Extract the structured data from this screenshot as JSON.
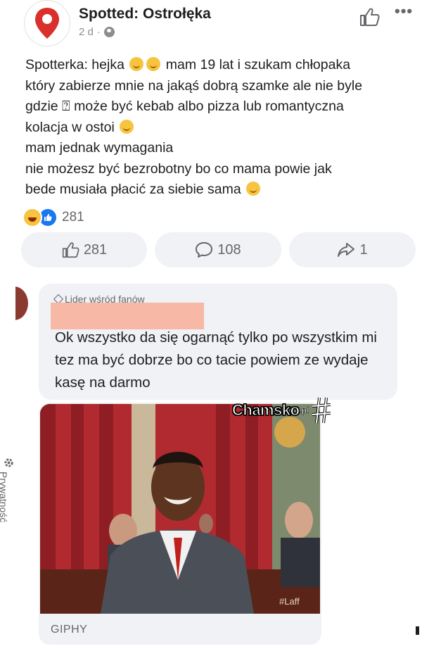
{
  "post": {
    "page_name": "Spotted: Ostrołęka",
    "time": "2 d",
    "separator": "·",
    "more": "•••",
    "lines": [
      {
        "before": "Spotterka: hejka ",
        "emojis": 2,
        "after": " mam 19 lat i szukam chłopaka"
      },
      {
        "before": "który zabierze mnie na jakąś dobrą szamke ale nie byle",
        "emojis": 0,
        "after": ""
      },
      {
        "before": "gdzie ⍰ może być kebab albo pizza lub romantyczna",
        "emojis": 0,
        "after": ""
      },
      {
        "before": "kolacja w ostoi ",
        "emojis": 1,
        "after": ""
      },
      {
        "before": "mam jednak wymagania",
        "emojis": 0,
        "after": ""
      },
      {
        "before": "nie możesz być bezrobotny bo co mama powie jak",
        "emojis": 0,
        "after": ""
      },
      {
        "before": "bede musiała płacić za siebie sama ",
        "emojis": 1,
        "after": ""
      }
    ],
    "reaction_count": "281"
  },
  "actions": {
    "like_count": "281",
    "comment_count": "108",
    "share_count": "1"
  },
  "comment": {
    "badge": "Lider wśród fanów",
    "text": "Ok wszystko da się ogarnąć tylko po wszystkim mi tez ma być dobrze bo co tacie powiem ze wydaje kasę na darmo",
    "gif_label": "GIPHY",
    "gif_caption": "#Laff"
  },
  "watermark": {
    "name": "Chamsko",
    "tld": ".pl"
  },
  "sidebar": {
    "privacy_label": "Prywatność"
  },
  "colors": {
    "accent_blue": "#1877f2",
    "bubble_bg": "#f0f2f5",
    "muted_text": "#65676b",
    "redaction": "#f7b9a6"
  }
}
